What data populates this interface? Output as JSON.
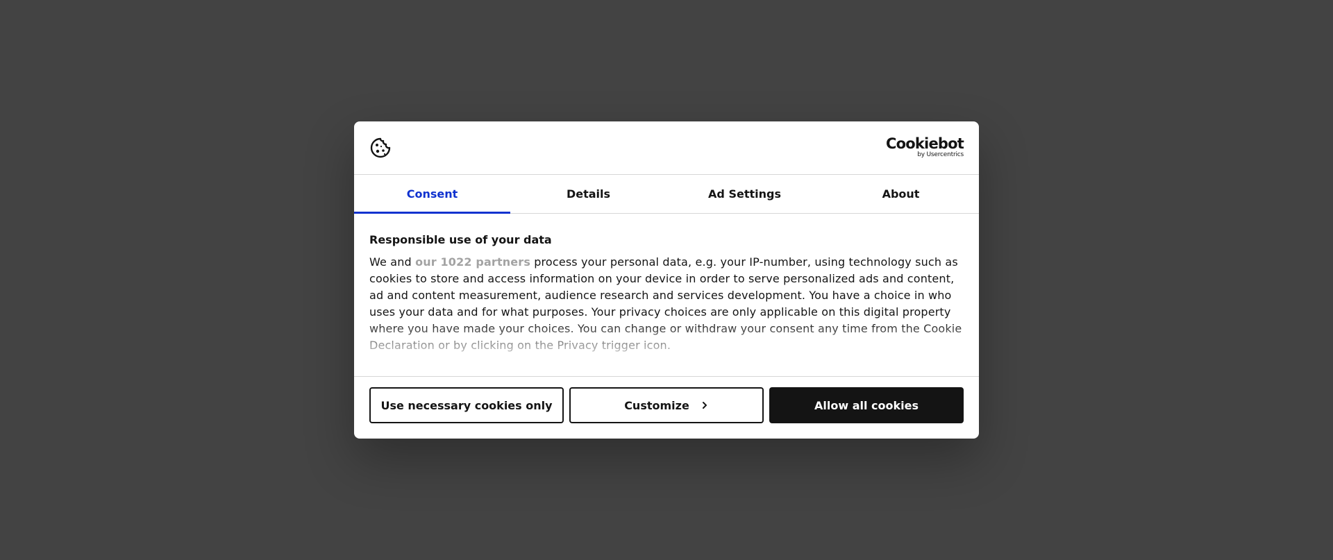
{
  "colors": {
    "overlay": "#434343",
    "accent": "#1032cf",
    "text": "#141414",
    "muted_link": "#a3a3a3"
  },
  "header": {
    "icon": "cookie-icon",
    "brand_main": "Cookiebot",
    "brand_sub": "by Usercentrics"
  },
  "tabs": [
    {
      "label": "Consent",
      "active": true
    },
    {
      "label": "Details",
      "active": false
    },
    {
      "label": "Ad Settings",
      "active": false
    },
    {
      "label": "About",
      "active": false
    }
  ],
  "content": {
    "title": "Responsible use of your data",
    "intro": "We and ",
    "partners_link": "our 1022 partners",
    "body": " process your personal data, e.g. your IP-number, using technology such as cookies to store and access information on your device in order to serve personalized ads and content, ad and content measurement, audience research and services development. You have a choice in who uses your data and for what purposes. Your privacy choices are only applicable on this digital property where you have made your choices. You can change or withdraw your consent any time from the Cookie Declaration or by clicking on the Privacy trigger icon."
  },
  "buttons": {
    "necessary": "Use necessary cookies only",
    "customize": "Customize",
    "customize_icon": "chevron-right-icon",
    "allow_all": "Allow all cookies"
  }
}
